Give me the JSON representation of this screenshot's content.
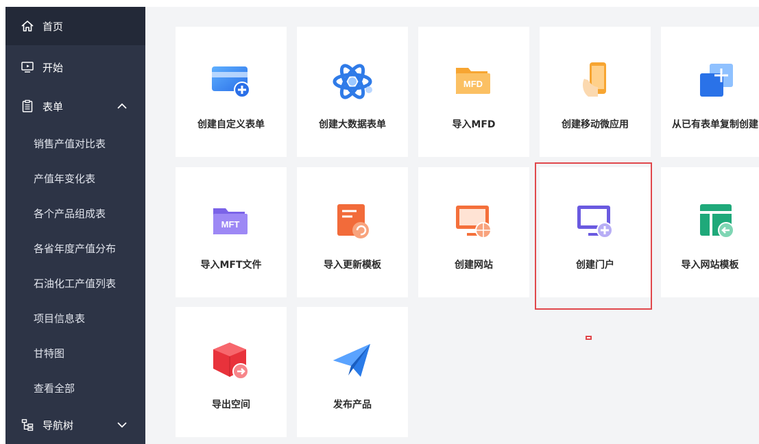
{
  "sidebar": {
    "items": [
      {
        "label": "首页",
        "icon": "home-icon"
      },
      {
        "label": "开始",
        "icon": "play-screen-icon"
      },
      {
        "label": "表单",
        "icon": "clipboard-list-icon"
      },
      {
        "label": "导航树",
        "icon": "tree-icon"
      }
    ],
    "form_subitems": [
      "销售产值对比表",
      "产值年变化表",
      "各个产品组成表",
      "各省年度产值分布",
      "石油化工产值列表",
      "项目信息表",
      "甘特图",
      "查看全部"
    ]
  },
  "cards": [
    {
      "label": "创建自定义表单",
      "icon": "custom-form-icon"
    },
    {
      "label": "创建大数据表单",
      "icon": "atom-icon"
    },
    {
      "label": "导入MFD",
      "icon": "mfd-folder-icon",
      "icon_text": "MFD"
    },
    {
      "label": "创建移动微应用",
      "icon": "mobile-phone-icon"
    },
    {
      "label": "从已有表单复制创建",
      "icon": "copy-form-icon"
    },
    {
      "label": "导入MFT文件",
      "icon": "mft-folder-icon",
      "icon_text": "MFT"
    },
    {
      "label": "导入更新模板",
      "icon": "update-template-icon"
    },
    {
      "label": "创建网站",
      "icon": "website-monitor-icon"
    },
    {
      "label": "创建门户",
      "icon": "portal-monitor-icon"
    },
    {
      "label": "导入网站模板",
      "icon": "site-template-icon"
    },
    {
      "label": "导出空间",
      "icon": "export-cube-icon"
    },
    {
      "label": "发布产品",
      "icon": "paper-plane-icon"
    }
  ],
  "colors": {
    "sidebar_bg": "#2d3446",
    "sidebar_active": "#232938",
    "main_bg": "#f3f4f6",
    "highlight": "#e0474b"
  }
}
